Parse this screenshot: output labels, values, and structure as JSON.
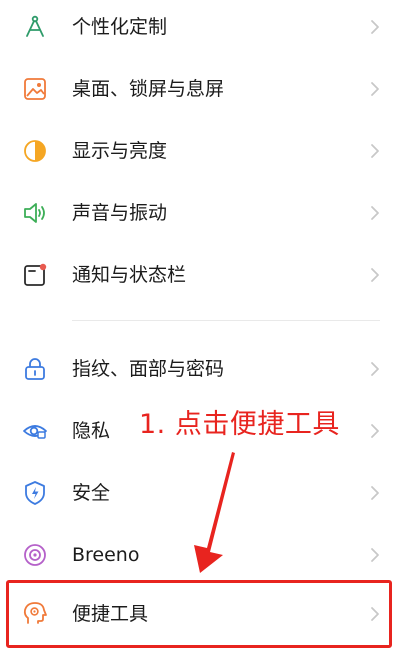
{
  "settings": {
    "items": [
      {
        "label": "个性化定制",
        "icon": "compass-icon",
        "icon_color": "#2e9b6a"
      },
      {
        "label": "桌面、锁屏与息屏",
        "icon": "wallpaper-icon",
        "icon_color": "#f07a3a"
      },
      {
        "label": "显示与亮度",
        "icon": "brightness-icon",
        "icon_color": "#f5a623"
      },
      {
        "label": "声音与振动",
        "icon": "speaker-icon",
        "icon_color": "#3dae57"
      },
      {
        "label": "通知与状态栏",
        "icon": "notification-icon",
        "icon_color": "#e85a4f"
      },
      {
        "label": "指纹、面部与密码",
        "icon": "lock-icon",
        "icon_color": "#3d7be0"
      },
      {
        "label": "隐私",
        "icon": "privacy-eye-icon",
        "icon_color": "#3d7be0"
      },
      {
        "label": "安全",
        "icon": "shield-icon",
        "icon_color": "#3d7be0"
      },
      {
        "label": "Breeno",
        "icon": "breeno-icon",
        "icon_color": "#b561c9"
      },
      {
        "label": "便捷工具",
        "icon": "convenience-tools-icon",
        "icon_color": "#f07a3a"
      }
    ]
  },
  "annotation": {
    "text": "1. 点击便捷工具",
    "color": "#e8241f"
  },
  "colors": {
    "chevron": "#c8c8c8",
    "divider": "#e9e9e9",
    "highlight": "#e8241f"
  }
}
